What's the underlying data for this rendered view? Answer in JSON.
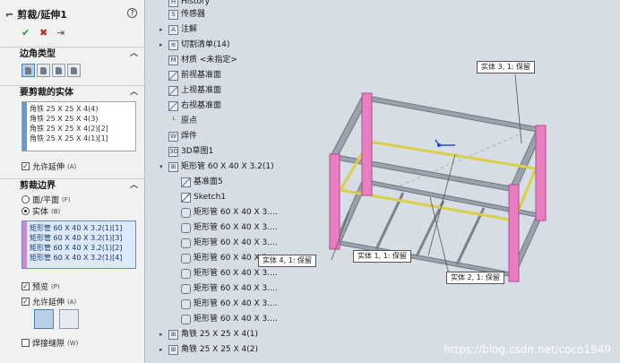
{
  "property_manager": {
    "title": "剪裁/延伸1",
    "help": "?",
    "ok": "✔",
    "cancel": "✖",
    "pin": "⇥",
    "corner_type_header": "边角类型",
    "bodies_header": "要剪裁的实体",
    "bodies": [
      "角铁 25 X 25 X 4(4)",
      "角铁 25 X 25 X 4(3)",
      "角铁 25 X 25 X 4(2)[2]",
      "角铁 25 X 25 X 4(1)[1]"
    ],
    "allow_extend_1": "允许延伸",
    "allow_extend_1_key": "(A)",
    "trim_boundary_header": "剪裁边界",
    "face_plane": "面/平面",
    "face_plane_key": "(F)",
    "body": "实体",
    "body_key": "(B)",
    "boundary_bodies": [
      "矩形管 60 X 40 X 3.2(1)[1]",
      "矩形管 60 X 40 X 3.2(1)[3]",
      "矩形管 60 X 40 X 3.2(1)[2]",
      "矩形管 60 X 40 X 3.2(1)[4]"
    ],
    "preview": "预览",
    "preview_key": "(P)",
    "allow_extend_2": "允许延伸",
    "allow_extend_2_key": "(A)",
    "weld_gap": "焊接缝隙",
    "weld_gap_key": "(W)",
    "accent_pink": "#e97fc0",
    "accent_blue": "#5b9be0"
  },
  "tree": {
    "items": [
      {
        "label": "History",
        "y": 0
      },
      {
        "label": "传感器"
      },
      {
        "label": "注解"
      },
      {
        "label": "切割清单(14)"
      },
      {
        "label": "材质 <未指定>"
      },
      {
        "label": "前视基准面"
      },
      {
        "label": "上视基准面"
      },
      {
        "label": "右视基准面"
      },
      {
        "label": "原点"
      },
      {
        "label": "焊件"
      },
      {
        "label": "3D草图1"
      },
      {
        "label": "矩形管 60 X 40 X 3.2(1)"
      },
      {
        "label": "基准面5"
      },
      {
        "label": "Sketch1"
      },
      {
        "label": "矩形管 60 X 40 X 3...."
      },
      {
        "label": "矩形管 60 X 40 X 3...."
      },
      {
        "label": "矩形管 60 X 40 X 3...."
      },
      {
        "label": "矩形管 60 X 40 X 3...."
      },
      {
        "label": "矩形管 60 X 40 X 3...."
      },
      {
        "label": "矩形管 60 X 40 X 3...."
      },
      {
        "label": "矩形管 60 X 40 X 3...."
      },
      {
        "label": "矩形管 60 X 40 X 3...."
      },
      {
        "label": "角铁 25 X 25 X 4(1)"
      },
      {
        "label": "角铁 25 X 25 X 4(2)"
      }
    ]
  },
  "graphics": {
    "callouts": [
      {
        "name": "callout-3",
        "text": "实体  3,   1:   保留"
      },
      {
        "name": "callout-4",
        "text": "实体  4,   1:   保留"
      },
      {
        "name": "callout-1",
        "text": "实体  1,   1:   保留"
      },
      {
        "name": "callout-2",
        "text": "实体  2,   1:   保留"
      }
    ],
    "watermark": "https://blog.csdn.net/coco1949"
  }
}
